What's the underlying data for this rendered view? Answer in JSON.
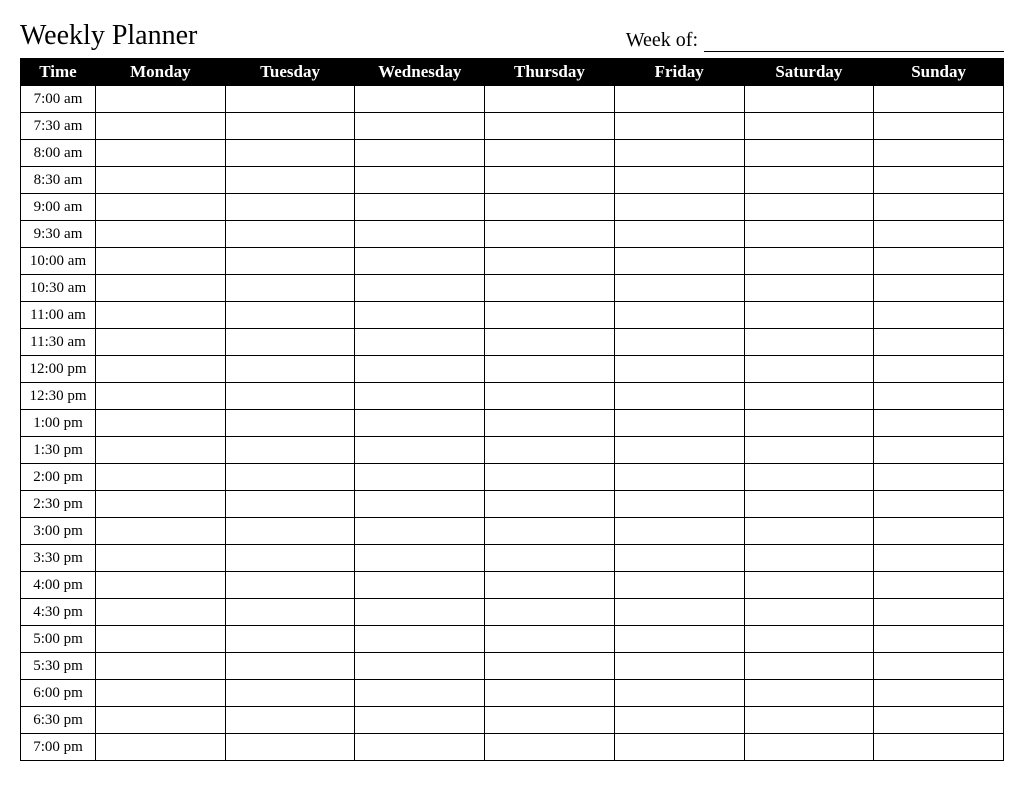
{
  "header": {
    "title": "Weekly Planner",
    "week_of_label": "Week of:"
  },
  "columns": {
    "time_header": "Time",
    "days": [
      "Monday",
      "Tuesday",
      "Wednesday",
      "Thursday",
      "Friday",
      "Saturday",
      "Sunday"
    ]
  },
  "times": [
    "7:00 am",
    "7:30 am",
    "8:00 am",
    "8:30 am",
    "9:00 am",
    "9:30 am",
    "10:00 am",
    "10:30 am",
    "11:00 am",
    "11:30 am",
    "12:00 pm",
    "12:30 pm",
    "1:00 pm",
    "1:30 pm",
    "2:00 pm",
    "2:30 pm",
    "3:00 pm",
    "3:30 pm",
    "4:00 pm",
    "4:30 pm",
    "5:00 pm",
    "5:30 pm",
    "6:00 pm",
    "6:30 pm",
    "7:00 pm"
  ]
}
